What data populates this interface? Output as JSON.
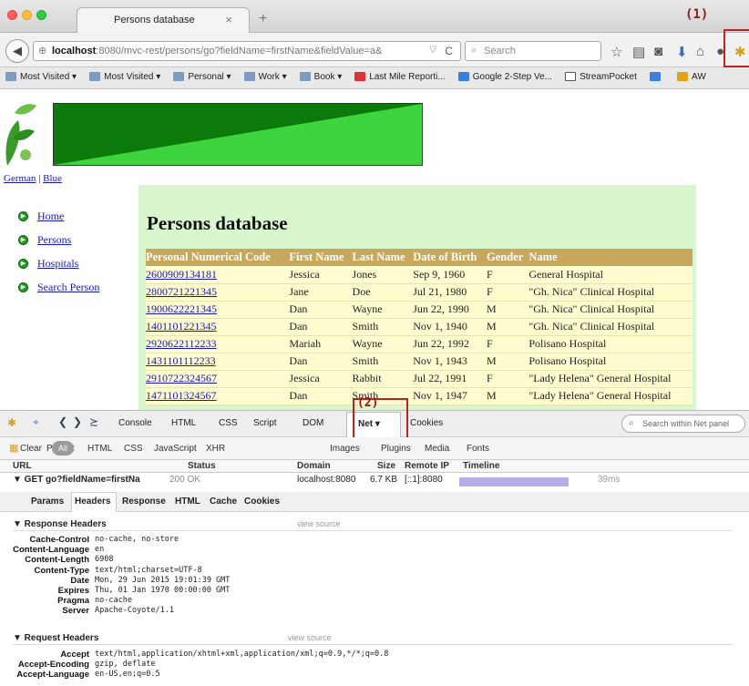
{
  "browser": {
    "tab_title": "Persons database",
    "tab_close": "×",
    "new_tab": "+",
    "url_host": "localhost",
    "url_rest": ":8080/mvc-rest/persons/go?fieldName=firstName&fieldValue=a&",
    "search_placeholder": "Search",
    "annotation_1": "(1)",
    "bookmarks": [
      "Most Visited ▾",
      "Most Visited ▾",
      "Personal ▾",
      "Work ▾",
      "Book ▾",
      "Last Mile Reporti...",
      "Google 2-Step Ve...",
      "StreamPocket",
      "",
      "AW"
    ]
  },
  "page": {
    "languages": {
      "german": "German",
      "separator": "|",
      "blue": "Blue"
    },
    "nav": [
      "Home",
      "Persons",
      "Hospitals",
      "Search Person"
    ],
    "title": "Persons database",
    "columns": [
      "Personal Numerical Code",
      "First Name",
      "Last Name",
      "Date of Birth",
      "Gender",
      "Name"
    ],
    "rows": [
      [
        "2600909134181",
        "Jessica",
        "Jones",
        "Sep 9, 1960",
        "F",
        "General Hospital"
      ],
      [
        "2800721221345",
        "Jane",
        "Doe",
        "Jul 21, 1980",
        "F",
        "\"Gh. Nica\" Clinical Hospital"
      ],
      [
        "1900622221345",
        "Dan",
        "Wayne",
        "Jun 22, 1990",
        "M",
        "\"Gh. Nica\" Clinical Hospital"
      ],
      [
        "1401101221345",
        "Dan",
        "Smith",
        "Nov 1, 1940",
        "M",
        "\"Gh. Nica\" Clinical Hospital"
      ],
      [
        "2920622112233",
        "Mariah",
        "Wayne",
        "Jun 22, 1992",
        "F",
        "Polisano Hospital"
      ],
      [
        "1431101112233",
        "Dan",
        "Smith",
        "Nov 1, 1943",
        "M",
        "Polisano Hospital"
      ],
      [
        "2910722324567",
        "Jessica",
        "Rabbit",
        "Jul 22, 1991",
        "F",
        "\"Lady Helena\" General Hospital"
      ],
      [
        "1471101324567",
        "Dan",
        "Smith",
        "Nov 1, 1947",
        "M",
        "\"Lady Helena\" General Hospital"
      ]
    ]
  },
  "firebug": {
    "tabs": [
      "Console",
      "HTML",
      "CSS",
      "Script",
      "DOM",
      "Net ▾",
      "Cookies"
    ],
    "annotation_2": "(2)",
    "search_placeholder": "Search within Net panel",
    "filters": [
      "Clear",
      "Persist",
      "All",
      "HTML",
      "CSS",
      "JavaScript",
      "XHR",
      "Images",
      "Plugins",
      "Media",
      "Fonts"
    ],
    "columns": [
      "URL",
      "Status",
      "Domain",
      "Size",
      "Remote IP",
      "Timeline"
    ],
    "request": {
      "url": "▼ GET go?fieldName=firstNa",
      "status": "200 OK",
      "domain": "localhost:8080",
      "size": "6.7 KB",
      "ip": "[::1]:8080",
      "time": "39ms"
    },
    "subtabs": [
      "Params",
      "Headers",
      "Response",
      "HTML",
      "Cache",
      "Cookies"
    ],
    "response_title": "▼ Response Headers",
    "request_title": "▼ Request Headers",
    "view_source": "view source",
    "response_headers": [
      {
        "name": "Cache-Control",
        "value": "no-cache, no-store"
      },
      {
        "name": "Content-Language",
        "value": "en"
      },
      {
        "name": "Content-Length",
        "value": "6908"
      },
      {
        "name": "Content-Type",
        "value": "text/html;charset=UTF-8"
      },
      {
        "name": "Date",
        "value": "Mon, 29 Jun 2015 19:01:39 GMT"
      },
      {
        "name": "Expires",
        "value": "Thu, 01 Jan 1970 00:00:00 GMT"
      },
      {
        "name": "Pragma",
        "value": "no-cache"
      },
      {
        "name": "Server",
        "value": "Apache-Coyote/1.1"
      }
    ],
    "request_headers": [
      {
        "name": "Accept",
        "value": "text/html,application/xhtml+xml,application/xml;q=0.9,*/*;q=0.8"
      },
      {
        "name": "Accept-Encoding",
        "value": "gzip, deflate"
      },
      {
        "name": "Accept-Language",
        "value": "en-US,en;q=0.5"
      }
    ]
  }
}
